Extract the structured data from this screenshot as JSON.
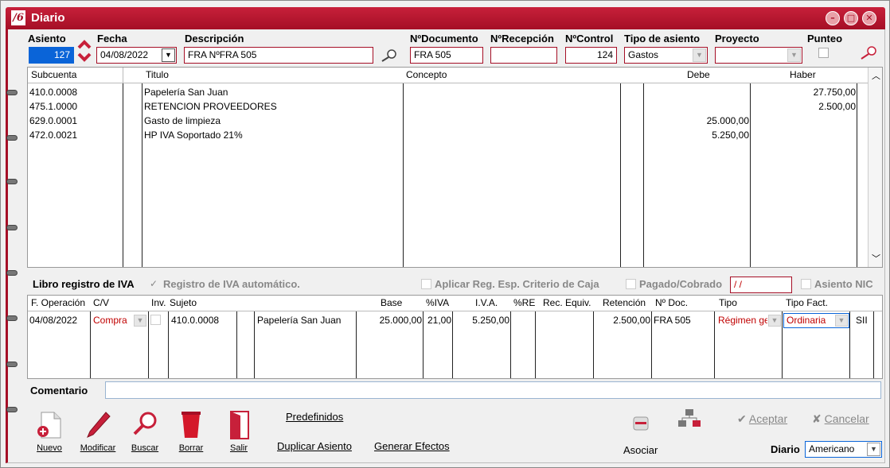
{
  "window": {
    "title": "Diario",
    "logo": "/6",
    "min_icon": "minimize-icon",
    "max_icon": "maximize-icon",
    "close_icon": "close-icon"
  },
  "header": {
    "asiento_label": "Asiento",
    "asiento_value": "127",
    "fecha_label": "Fecha",
    "fecha_value": "04/08/2022",
    "descripcion_label": "Descripción",
    "descripcion_value": "FRA NºFRA 505",
    "ndocumento_label": "NºDocumento",
    "ndocumento_value": "FRA 505",
    "nrecepcion_label": "NºRecepción",
    "nrecepcion_value": "",
    "ncontrol_label": "NºControl",
    "ncontrol_value": "124",
    "tipo_label": "Tipo de asiento",
    "tipo_value": "Gastos",
    "proyecto_label": "Proyecto",
    "proyecto_value": "",
    "punteo_label": "Punteo"
  },
  "entries": {
    "columns": [
      "Subcuenta",
      "Titulo",
      "Concepto",
      "Debe",
      "Haber"
    ],
    "rows": [
      {
        "subcuenta": "410.0.0008",
        "titulo": "Papelería San Juan",
        "concepto": "",
        "debe": "",
        "haber": "27.750,00"
      },
      {
        "subcuenta": "475.1.0000",
        "titulo": "RETENCION PROVEEDORES",
        "concepto": "",
        "debe": "",
        "haber": "2.500,00"
      },
      {
        "subcuenta": "629.0.0001",
        "titulo": "Gasto de limpieza",
        "concepto": "",
        "debe": "25.000,00",
        "haber": ""
      },
      {
        "subcuenta": "472.0.0021",
        "titulo": "HP IVA Soportado 21%",
        "concepto": "",
        "debe": "5.250,00",
        "haber": ""
      }
    ]
  },
  "iva": {
    "section_label": "Libro registro de IVA",
    "auto_label": "Registro de IVA automático.",
    "criterio_label": "Aplicar Reg. Esp. Criterio de Caja",
    "pagado_label": "Pagado/Cobrado",
    "pagado_date": " / /",
    "nic_label": "Asiento NIC",
    "columns": [
      "F. Operación",
      "C/V",
      "Inv.",
      "Sujeto",
      "",
      "Base",
      "%IVA",
      "I.V.A.",
      "%RE",
      "Rec. Equiv.",
      "Retención",
      "Nº Doc.",
      "Tipo",
      "Tipo Fact."
    ],
    "row": {
      "fecha": "04/08/2022",
      "cv": "Compra",
      "sujeto_code": "410.0.0008",
      "sujeto_name": "Papelería San Juan",
      "base": "25.000,00",
      "iva_pct": "21,00",
      "iva": "5.250,00",
      "re": "",
      "rec": "",
      "retencion": "2.500,00",
      "ndoc": "FRA 505",
      "tipo": "Régimen ge",
      "tipo_fact": "Ordinaria",
      "sii": "SII"
    }
  },
  "comment": {
    "label": "Comentario",
    "value": ""
  },
  "toolbar": {
    "nuevo": "Nuevo",
    "modificar": "Modificar",
    "buscar": "Buscar",
    "borrar": "Borrar",
    "salir": "Salir",
    "predefinidos": "Predefinidos",
    "duplicar": "Duplicar Asiento",
    "generar": "Generar Efectos",
    "asociar": "Asociar",
    "aceptar": "Aceptar",
    "cancelar": "Cancelar",
    "diario_label": "Diario",
    "diario_value": "Americano"
  },
  "colors": {
    "accent": "#a50f26",
    "title_bg": "#c7203a",
    "text_red": "#c00000",
    "selection": "#0a64d8"
  }
}
